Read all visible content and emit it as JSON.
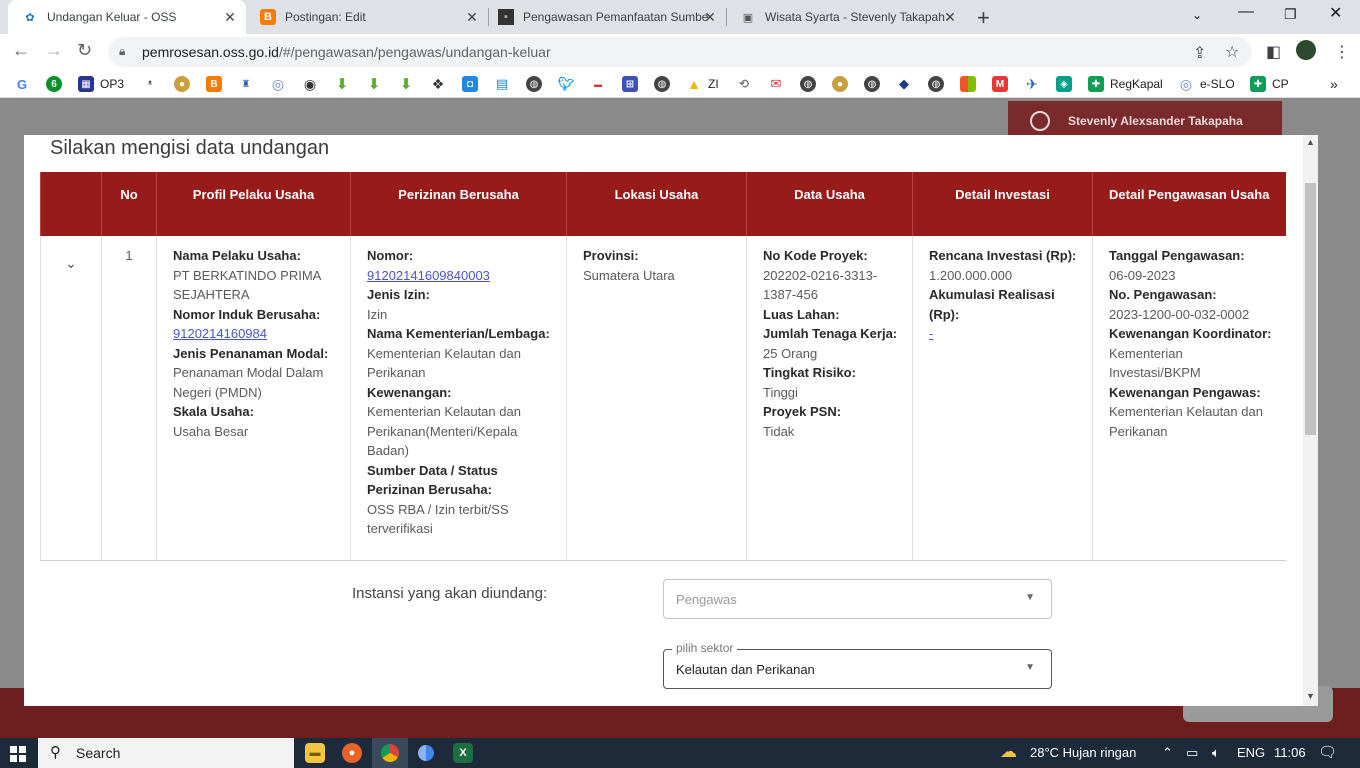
{
  "browser": {
    "tabs": [
      {
        "title": "Undangan Keluar - OSS",
        "icon": "oss-icon",
        "active": true
      },
      {
        "title": "Postingan: Edit",
        "icon": "blogger-icon",
        "active": false
      },
      {
        "title": "Pengawasan Pemanfaatan Sumbe",
        "icon": "image-icon",
        "active": false
      },
      {
        "title": "Wisata Syarta - Stevenly Takapah",
        "icon": "page-icon",
        "active": false
      }
    ],
    "url_host": "pemrosesan.oss.go.id",
    "url_path": "/#/pengawasan/pengawas/undangan-keluar",
    "bookmarks": [
      {
        "label": "OP3"
      },
      {
        "label": "ZI"
      },
      {
        "label": "RegKapal"
      },
      {
        "label": "e-SLO"
      },
      {
        "label": "CP"
      }
    ]
  },
  "page": {
    "user_name": "Stevenly Alexsander Takapaha"
  },
  "modal": {
    "title": "Silakan mengisi data undangan",
    "columns": [
      "No",
      "Profil Pelaku Usaha",
      "Perizinan Berusaha",
      "Lokasi Usaha",
      "Data Usaha",
      "Detail Investasi",
      "Detail Pengawasan Usaha"
    ],
    "row": {
      "no": "1",
      "profil": {
        "nama_label": "Nama Pelaku Usaha:",
        "nama": "PT BERKATINDO PRIMA SEJAHTERA",
        "nib_label": "Nomor Induk Berusaha:",
        "nib": "9120214160984",
        "jenis_label": "Jenis Penanaman Modal:",
        "jenis": "Penanaman Modal Dalam Negeri (PMDN)",
        "skala_label": "Skala Usaha:",
        "skala": "Usaha Besar"
      },
      "perizinan": {
        "nomor_label": "Nomor:",
        "nomor": "91202141609840003",
        "jenis_label": "Jenis Izin:",
        "jenis": "Izin",
        "kementerian_label": "Nama Kementerian/Lembaga:",
        "kementerian": "Kementerian Kelautan dan Perikanan",
        "kewenangan_label": "Kewenangan:",
        "kewenangan": "Kementerian Kelautan dan Perikanan(Menteri/Kepala Badan)",
        "sumber_label": "Sumber Data / Status Perizinan Berusaha:",
        "sumber": "OSS RBA / Izin terbit/SS terverifikasi"
      },
      "lokasi": {
        "provinsi_label": "Provinsi:",
        "provinsi": "Sumatera Utara"
      },
      "data_usaha": {
        "kode_label": "No Kode Proyek:",
        "kode": "202202-0216-3313-1387-456",
        "luas_label": "Luas Lahan:",
        "tenaga_label": "Jumlah Tenaga Kerja:",
        "tenaga": "25 Orang",
        "risiko_label": "Tingkat Risiko:",
        "risiko": "Tinggi",
        "psn_label": "Proyek PSN:",
        "psn": "Tidak"
      },
      "investasi": {
        "rencana_label": "Rencana Investasi (Rp):",
        "rencana": "1.200.000.000",
        "realisasi_label": "Akumulasi Realisasi (Rp):",
        "realisasi": "-"
      },
      "pengawasan": {
        "tanggal_label": "Tanggal Pengawasan:",
        "tanggal": "06-09-2023",
        "no_label": "No. Pengawasan:",
        "no": "2023-1200-00-032-0002",
        "koordinator_label": "Kewenangan Koordinator:",
        "koordinator": "Kementerian Investasi/BKPM",
        "pengawas_label": "Kewenangan Pengawas:",
        "pengawas": "Kementerian Kelautan dan Perikanan"
      }
    },
    "instansi_label": "Instansi yang akan diundang:",
    "pengawas_placeholder": "Pengawas",
    "sektor_legend": "pilih sektor",
    "sektor_value": "Kelautan dan Perikanan"
  },
  "taskbar": {
    "search_label": "Search",
    "weather": "28°C  Hujan ringan",
    "lang": "ENG",
    "time": "11:06"
  }
}
